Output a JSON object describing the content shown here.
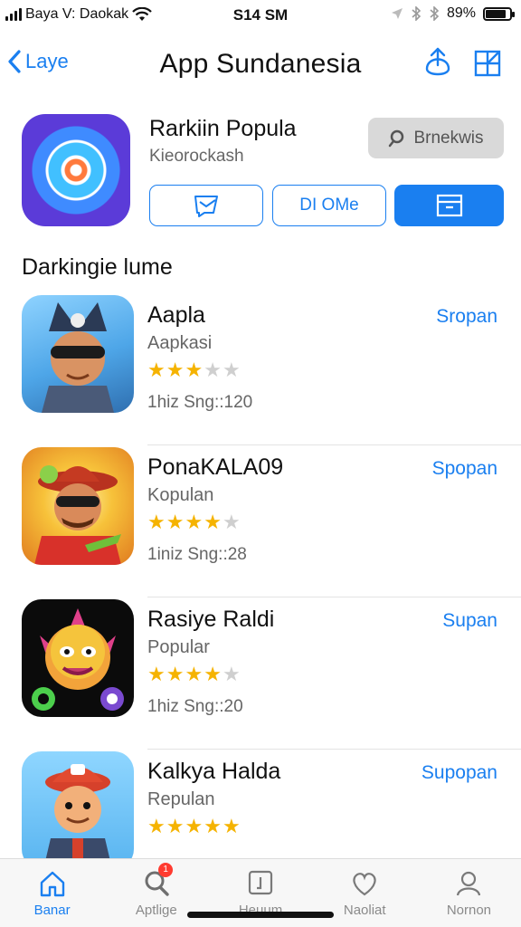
{
  "status_bar": {
    "carrier": "Baya V: Daokak",
    "time": "S14 SM",
    "battery": "89%",
    "battery_level": 0.85
  },
  "nav": {
    "back_label": "Laye",
    "title": "App Sundanesia",
    "icons": [
      "share-icon",
      "grid-icon"
    ]
  },
  "featured": {
    "title": "Rarkiin Popula",
    "subtitle": "Kieorockash",
    "browse_label": "Brnekwis",
    "action_2_label": "DI OMe"
  },
  "section_title": "Darkingie lume",
  "apps": [
    {
      "name": "Aapla",
      "category": "Aapkasi",
      "rating": 3,
      "size": "1hiz Sng::120",
      "action": "Sropan",
      "icon": "cat-ninja-character-icon"
    },
    {
      "name": "PonaKALA09",
      "category": "Kopulan",
      "rating": 4,
      "size": "1iniz Sng::28",
      "action": "Spopan",
      "icon": "cowboy-character-icon"
    },
    {
      "name": "Rasiye Raldi",
      "category": "Popular",
      "rating": 4,
      "size": "1hiz Sng::20",
      "action": "Supan",
      "icon": "monster-character-icon"
    },
    {
      "name": "Kalkya Halda",
      "category": "Repulan",
      "rating": 5,
      "size": "",
      "action": "Supopan",
      "icon": "firefighter-character-icon"
    }
  ],
  "tabs": [
    {
      "label": "Banar",
      "icon": "home-icon",
      "active": true
    },
    {
      "label": "Aptlige",
      "icon": "search-icon",
      "badge": "1"
    },
    {
      "label": "Heuum",
      "icon": "document-icon"
    },
    {
      "label": "Naoliat",
      "icon": "heart-icon"
    },
    {
      "label": "Nornon",
      "icon": "profile-icon"
    }
  ],
  "colors": {
    "accent": "#1a7ff0",
    "star": "#f5b301",
    "badge": "#ff3b30"
  }
}
